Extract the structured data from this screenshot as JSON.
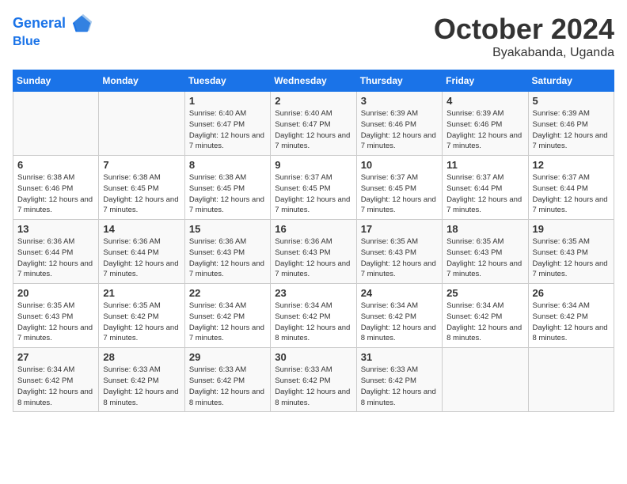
{
  "header": {
    "logo_line1": "General",
    "logo_line2": "Blue",
    "month_title": "October 2024",
    "location": "Byakabanda, Uganda"
  },
  "days_of_week": [
    "Sunday",
    "Monday",
    "Tuesday",
    "Wednesday",
    "Thursday",
    "Friday",
    "Saturday"
  ],
  "weeks": [
    [
      {
        "day": "",
        "info": ""
      },
      {
        "day": "",
        "info": ""
      },
      {
        "day": "1",
        "info": "Sunrise: 6:40 AM\nSunset: 6:47 PM\nDaylight: 12 hours and 7 minutes."
      },
      {
        "day": "2",
        "info": "Sunrise: 6:40 AM\nSunset: 6:47 PM\nDaylight: 12 hours and 7 minutes."
      },
      {
        "day": "3",
        "info": "Sunrise: 6:39 AM\nSunset: 6:46 PM\nDaylight: 12 hours and 7 minutes."
      },
      {
        "day": "4",
        "info": "Sunrise: 6:39 AM\nSunset: 6:46 PM\nDaylight: 12 hours and 7 minutes."
      },
      {
        "day": "5",
        "info": "Sunrise: 6:39 AM\nSunset: 6:46 PM\nDaylight: 12 hours and 7 minutes."
      }
    ],
    [
      {
        "day": "6",
        "info": "Sunrise: 6:38 AM\nSunset: 6:46 PM\nDaylight: 12 hours and 7 minutes."
      },
      {
        "day": "7",
        "info": "Sunrise: 6:38 AM\nSunset: 6:45 PM\nDaylight: 12 hours and 7 minutes."
      },
      {
        "day": "8",
        "info": "Sunrise: 6:38 AM\nSunset: 6:45 PM\nDaylight: 12 hours and 7 minutes."
      },
      {
        "day": "9",
        "info": "Sunrise: 6:37 AM\nSunset: 6:45 PM\nDaylight: 12 hours and 7 minutes."
      },
      {
        "day": "10",
        "info": "Sunrise: 6:37 AM\nSunset: 6:45 PM\nDaylight: 12 hours and 7 minutes."
      },
      {
        "day": "11",
        "info": "Sunrise: 6:37 AM\nSunset: 6:44 PM\nDaylight: 12 hours and 7 minutes."
      },
      {
        "day": "12",
        "info": "Sunrise: 6:37 AM\nSunset: 6:44 PM\nDaylight: 12 hours and 7 minutes."
      }
    ],
    [
      {
        "day": "13",
        "info": "Sunrise: 6:36 AM\nSunset: 6:44 PM\nDaylight: 12 hours and 7 minutes."
      },
      {
        "day": "14",
        "info": "Sunrise: 6:36 AM\nSunset: 6:44 PM\nDaylight: 12 hours and 7 minutes."
      },
      {
        "day": "15",
        "info": "Sunrise: 6:36 AM\nSunset: 6:43 PM\nDaylight: 12 hours and 7 minutes."
      },
      {
        "day": "16",
        "info": "Sunrise: 6:36 AM\nSunset: 6:43 PM\nDaylight: 12 hours and 7 minutes."
      },
      {
        "day": "17",
        "info": "Sunrise: 6:35 AM\nSunset: 6:43 PM\nDaylight: 12 hours and 7 minutes."
      },
      {
        "day": "18",
        "info": "Sunrise: 6:35 AM\nSunset: 6:43 PM\nDaylight: 12 hours and 7 minutes."
      },
      {
        "day": "19",
        "info": "Sunrise: 6:35 AM\nSunset: 6:43 PM\nDaylight: 12 hours and 7 minutes."
      }
    ],
    [
      {
        "day": "20",
        "info": "Sunrise: 6:35 AM\nSunset: 6:43 PM\nDaylight: 12 hours and 7 minutes."
      },
      {
        "day": "21",
        "info": "Sunrise: 6:35 AM\nSunset: 6:42 PM\nDaylight: 12 hours and 7 minutes."
      },
      {
        "day": "22",
        "info": "Sunrise: 6:34 AM\nSunset: 6:42 PM\nDaylight: 12 hours and 7 minutes."
      },
      {
        "day": "23",
        "info": "Sunrise: 6:34 AM\nSunset: 6:42 PM\nDaylight: 12 hours and 8 minutes."
      },
      {
        "day": "24",
        "info": "Sunrise: 6:34 AM\nSunset: 6:42 PM\nDaylight: 12 hours and 8 minutes."
      },
      {
        "day": "25",
        "info": "Sunrise: 6:34 AM\nSunset: 6:42 PM\nDaylight: 12 hours and 8 minutes."
      },
      {
        "day": "26",
        "info": "Sunrise: 6:34 AM\nSunset: 6:42 PM\nDaylight: 12 hours and 8 minutes."
      }
    ],
    [
      {
        "day": "27",
        "info": "Sunrise: 6:34 AM\nSunset: 6:42 PM\nDaylight: 12 hours and 8 minutes."
      },
      {
        "day": "28",
        "info": "Sunrise: 6:33 AM\nSunset: 6:42 PM\nDaylight: 12 hours and 8 minutes."
      },
      {
        "day": "29",
        "info": "Sunrise: 6:33 AM\nSunset: 6:42 PM\nDaylight: 12 hours and 8 minutes."
      },
      {
        "day": "30",
        "info": "Sunrise: 6:33 AM\nSunset: 6:42 PM\nDaylight: 12 hours and 8 minutes."
      },
      {
        "day": "31",
        "info": "Sunrise: 6:33 AM\nSunset: 6:42 PM\nDaylight: 12 hours and 8 minutes."
      },
      {
        "day": "",
        "info": ""
      },
      {
        "day": "",
        "info": ""
      }
    ]
  ]
}
